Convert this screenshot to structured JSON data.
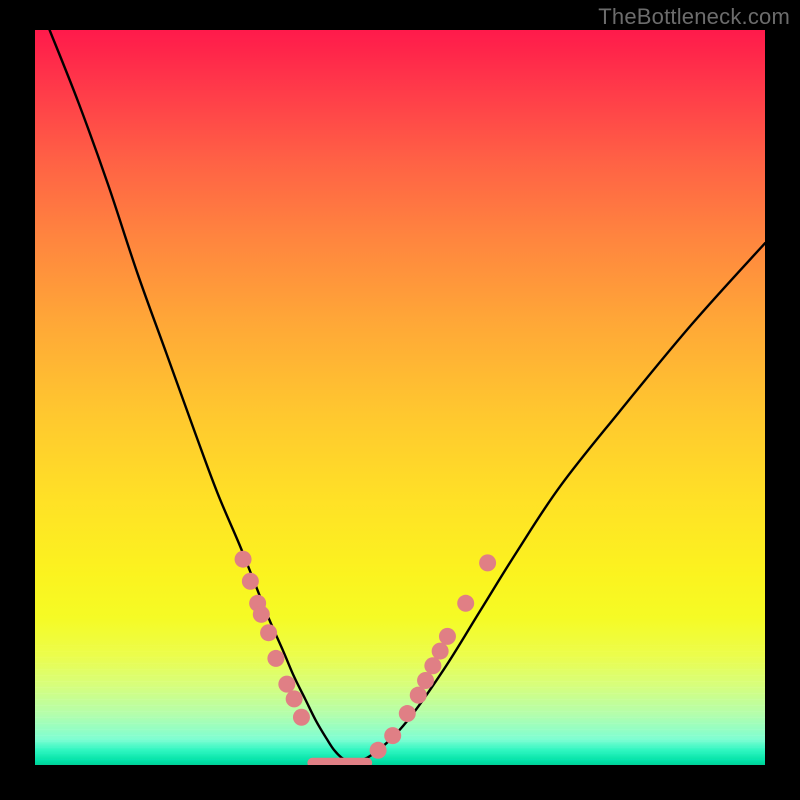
{
  "watermark": "TheBottleneck.com",
  "chart_data": {
    "type": "line",
    "title": "",
    "xlabel": "",
    "ylabel": "",
    "xlim": [
      0,
      100
    ],
    "ylim": [
      0,
      100
    ],
    "grid": false,
    "legend": false,
    "series": [
      {
        "name": "bottleneck-curve",
        "x": [
          2,
          6,
          10,
          14,
          18,
          22,
          25,
          28,
          30,
          32,
          34,
          35.5,
          37,
          38.5,
          40,
          41,
          42,
          43,
          44,
          47,
          51,
          56,
          61,
          66,
          72,
          80,
          90,
          100
        ],
        "y": [
          100,
          90,
          79,
          67,
          56,
          45,
          37,
          30,
          25,
          20,
          15.5,
          12,
          9,
          6,
          3.5,
          2,
          1,
          0.5,
          0.3,
          2,
          6,
          13,
          21,
          29,
          38,
          48,
          60,
          71
        ]
      }
    ],
    "markers": {
      "name": "highlight-dots",
      "color": "#e07f85",
      "points": [
        {
          "x": 28.5,
          "y": 28.0
        },
        {
          "x": 29.5,
          "y": 25.0
        },
        {
          "x": 30.5,
          "y": 22.0
        },
        {
          "x": 31.0,
          "y": 20.5
        },
        {
          "x": 32.0,
          "y": 18.0
        },
        {
          "x": 33.0,
          "y": 14.5
        },
        {
          "x": 34.5,
          "y": 11.0
        },
        {
          "x": 35.5,
          "y": 9.0
        },
        {
          "x": 36.5,
          "y": 6.5
        },
        {
          "x": 47.0,
          "y": 2.0
        },
        {
          "x": 49.0,
          "y": 4.0
        },
        {
          "x": 51.0,
          "y": 7.0
        },
        {
          "x": 52.5,
          "y": 9.5
        },
        {
          "x": 53.5,
          "y": 11.5
        },
        {
          "x": 54.5,
          "y": 13.5
        },
        {
          "x": 55.5,
          "y": 15.5
        },
        {
          "x": 56.5,
          "y": 17.5
        },
        {
          "x": 59.0,
          "y": 22.0
        },
        {
          "x": 62.0,
          "y": 27.5
        }
      ],
      "flat_segment": {
        "x1": 38.0,
        "x2": 45.5,
        "y": 0.3
      }
    },
    "gradient": {
      "top": "#ff1a4b",
      "mid": "#ffe126",
      "bottom": "#00d097"
    }
  }
}
